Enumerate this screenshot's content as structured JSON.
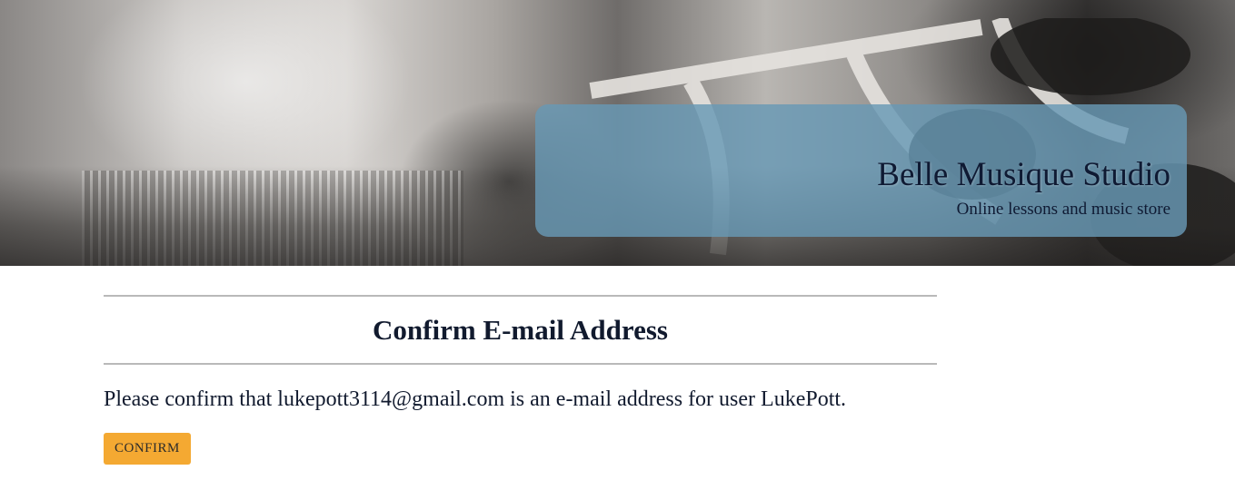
{
  "header": {
    "title": "Belle Musique Studio",
    "subtitle": "Online lessons and music store",
    "box_color": "#6898b4"
  },
  "main": {
    "page_title": "Confirm E-mail Address",
    "message_prefix": "Please confirm that ",
    "email": "lukepott3114@gmail.com",
    "message_middle": " is an e-mail address for user ",
    "username": "LukePott",
    "message_suffix": ".",
    "confirm_label": "CONFIRM",
    "confirm_color": "#f4a932"
  }
}
